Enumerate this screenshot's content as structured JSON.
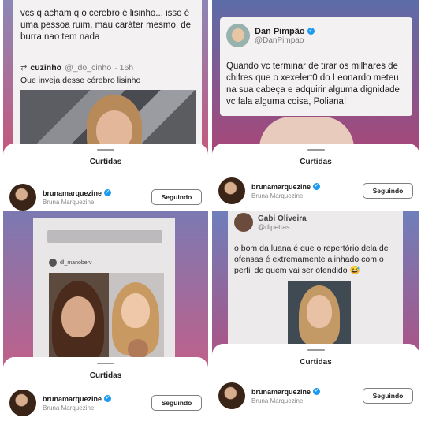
{
  "sheet": {
    "title": "Curtidas",
    "user": {
      "handle": "brunamarquezine",
      "display_name": "Bruna Marquezine",
      "follow_label": "Seguindo",
      "verified_icon": "✓"
    }
  },
  "panel1": {
    "tweet_text": "vcs q acham q o cerebro é lisinho... isso é uma pessoa ruim, mau caráter mesmo, de burra nao tem nada",
    "quote_name": "cuzinho",
    "quote_handle": "@_do_cinho",
    "quote_time": "· 16h",
    "quote_text": "Que inveja desse cérebro lisinho"
  },
  "panel2": {
    "name": "Dan Pimpão",
    "handle": "@DanPimpao",
    "tweet_text": "Quando vc terminar de tirar os milhares de chifres que o xexelert0 do Leonardo meteu na sua cabeça e adquirir alguma dignidade vc fala alguma coisa, Poliana!"
  },
  "panel3": {
    "story_handle": "dl_manoberv"
  },
  "panel4": {
    "name": "Gabi Oliveira",
    "handle": "@dipettas",
    "tweet_text": "o bom da luana é que o repertório dela de ofensas é extremamente alinhado com o perfil de quem vai ser ofendido 😅"
  }
}
